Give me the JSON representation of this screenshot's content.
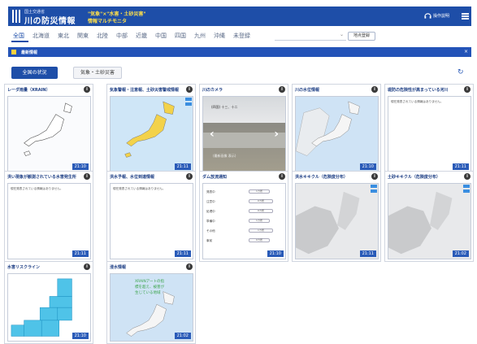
{
  "header": {
    "org": "国土交通省",
    "title": "川の防災情報",
    "slogan_line1": "\"気象\"×\"水害・土砂災害\"",
    "slogan_line2": "情報マルチモニタ",
    "help_label": "操作説明",
    "colors": {
      "bar": "#1e4ea8",
      "slogan": "#ffe14a"
    }
  },
  "regions": {
    "items": [
      "全国",
      "北海道",
      "東北",
      "関東",
      "北陸",
      "中部",
      "近畿",
      "中国",
      "四国",
      "九州",
      "沖縄",
      "未登録"
    ],
    "active": "全国",
    "search_placeholder": "",
    "register_label": "地点登録"
  },
  "notice": {
    "label": "最新情報",
    "close_icon": "close-icon"
  },
  "category_tabs": {
    "tab1": "全国の状況",
    "tab2": "気象・土砂災害",
    "refresh_icon": "refresh-icon"
  },
  "cards": [
    {
      "title": "レーダ雨量（XRAIN）",
      "time": "21:10"
    },
    {
      "title": "気象警報・注意報、土砂災害警戒情報",
      "time": "21:11"
    },
    {
      "title": "川のカメラ",
      "camera_label": "(四国) 十三、十二",
      "camera_caption": "(最新画像 表示)"
    },
    {
      "title": "川の水位情報",
      "time": "21:10"
    },
    {
      "title": "堤防の危険性が高まっている河川",
      "time": "21:11",
      "text": "現在発表されている情報はありません。"
    },
    {
      "title": "洪い現象が観測されている水害発生所",
      "time": "21:11",
      "text": "現在発表されている情報はありません。"
    },
    {
      "title": "洪水予報、水位到達情報",
      "time": "21:11",
      "text": "現在発表されている情報はありません。"
    },
    {
      "title": "ダム放流通知",
      "time": "21:10",
      "rows": [
        {
          "label": "発表中",
          "value": "1カ所"
        },
        {
          "label": "注意中",
          "value": "0カ所"
        },
        {
          "label": "処理中",
          "value": "0カ所"
        },
        {
          "label": "準備中",
          "value": "1カ所"
        },
        {
          "label": "その他",
          "value": "1カ所"
        },
        {
          "label": "事前",
          "value": "0カ所"
        }
      ]
    },
    {
      "title": "洪水キキクル（危険度分布）",
      "time": "21:11"
    },
    {
      "title": "土砂キキクル（危険度分布）",
      "time": "21:02"
    },
    {
      "title": "水害リスクライン",
      "time": "21:10"
    },
    {
      "title": "浸水情報",
      "time": "21:02",
      "text": "XRAINアートの指標を超え、被害が生じている地域"
    }
  ]
}
